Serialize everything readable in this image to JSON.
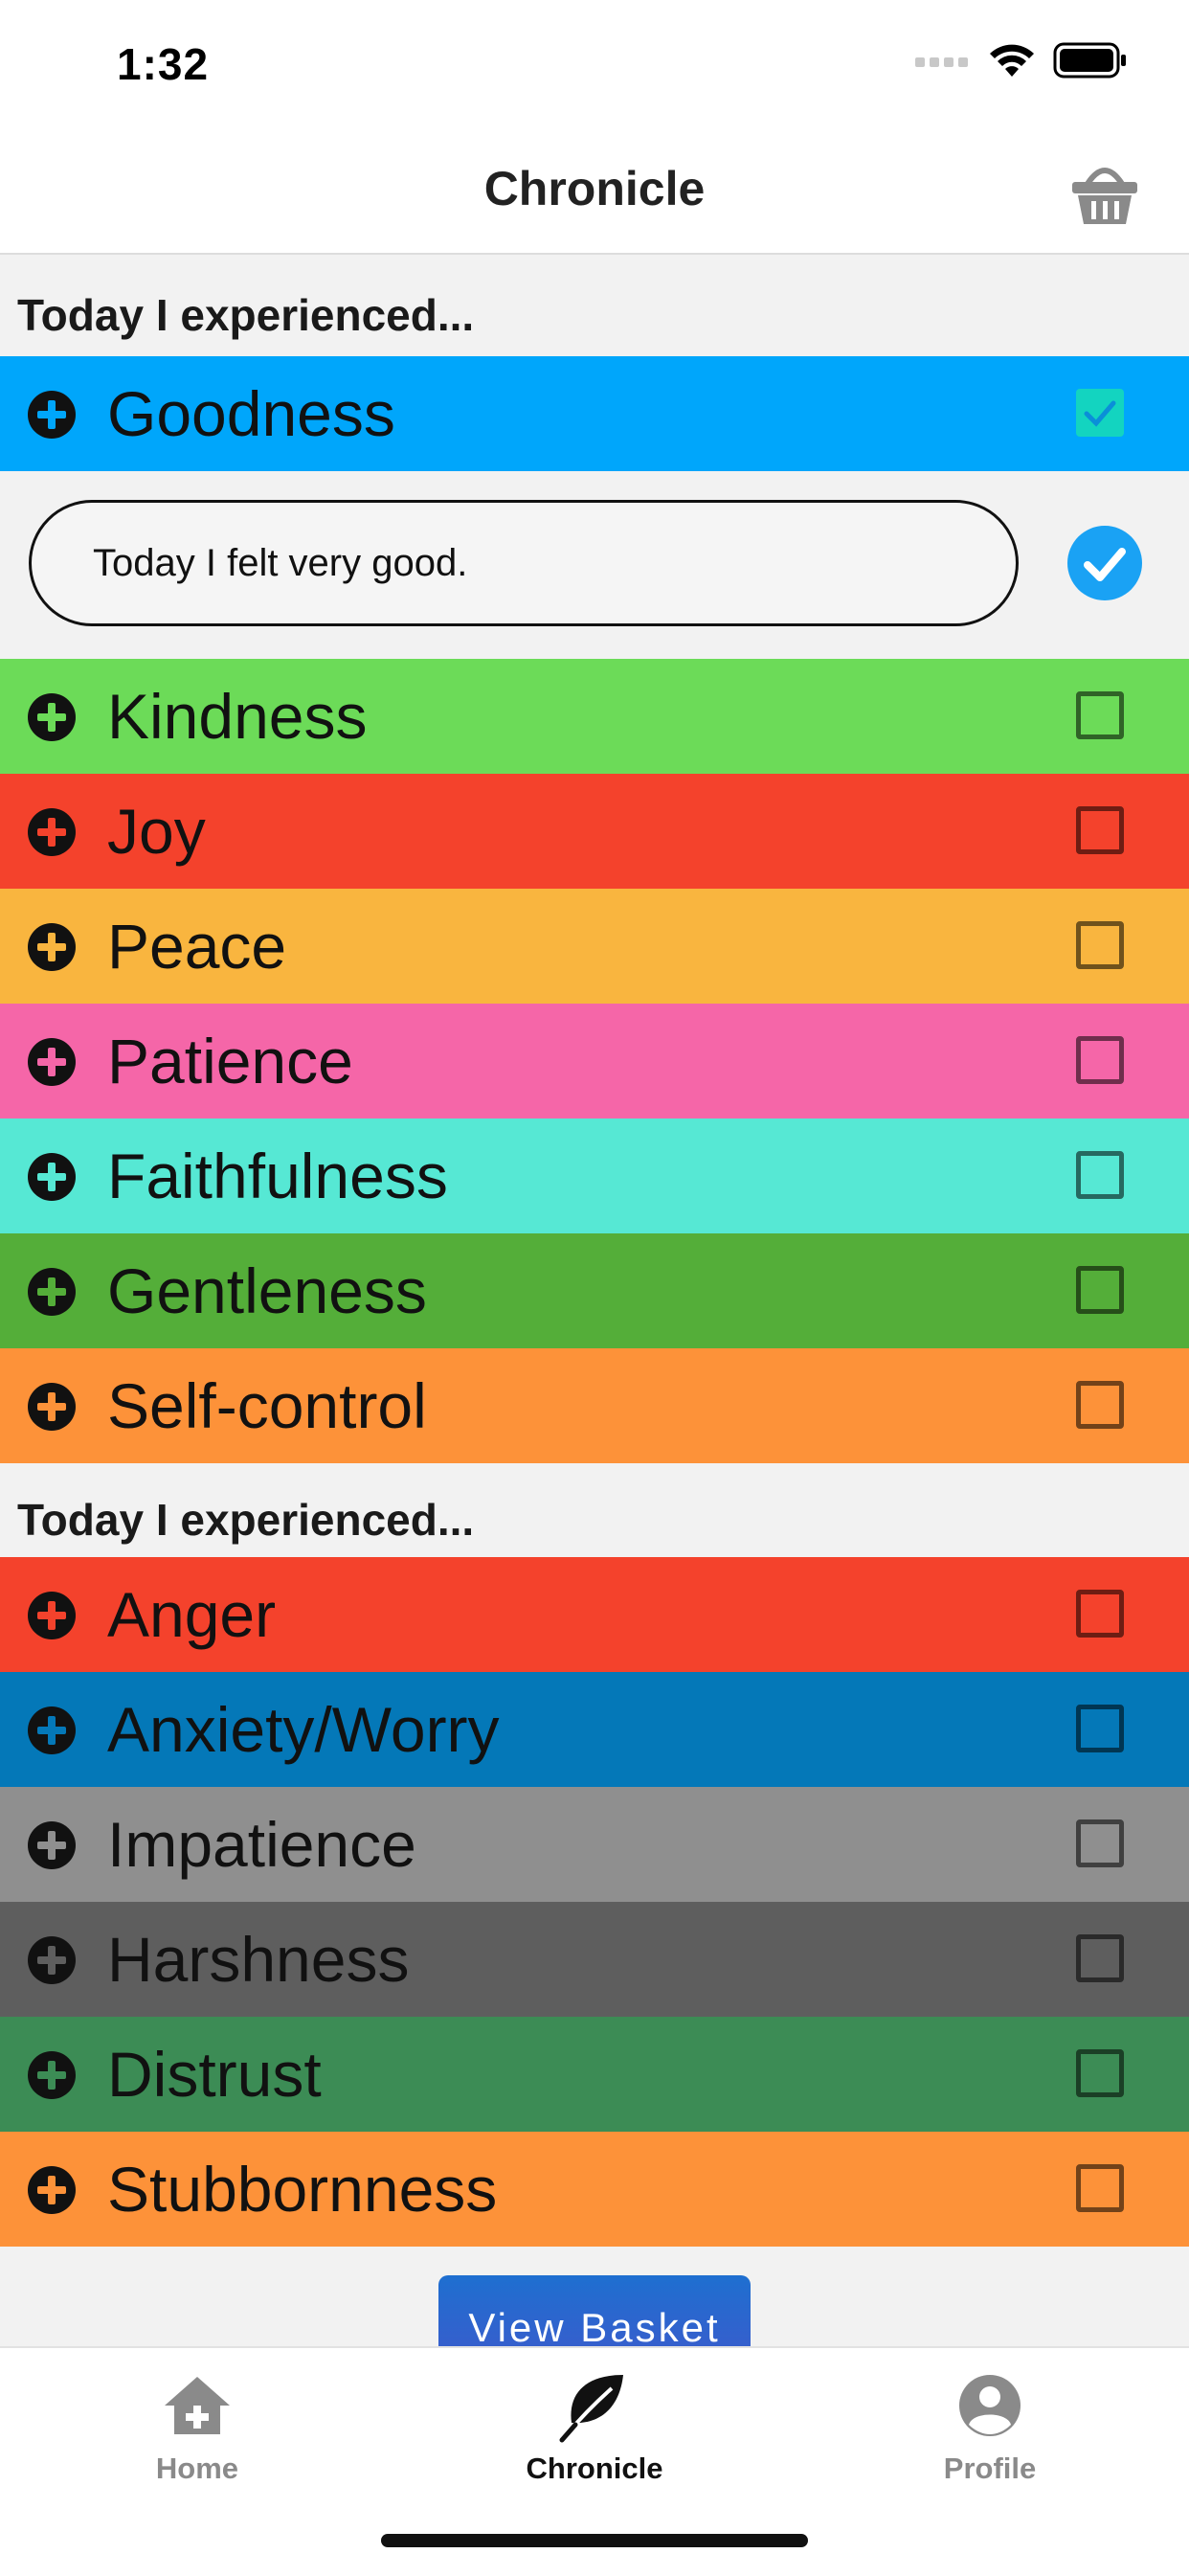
{
  "status_bar": {
    "time": "1:32"
  },
  "nav": {
    "title": "Chronicle",
    "basket_icon": "basket-icon"
  },
  "sections": {
    "fruits_header": "Today I experienced...",
    "struggles_header": "Today I experienced..."
  },
  "fruits": [
    {
      "label": "Goodness",
      "color": "#00a6fb",
      "checked": true
    },
    {
      "label": "Kindness",
      "color": "#6cdb58",
      "checked": false
    },
    {
      "label": "Joy",
      "color": "#f4422c",
      "checked": false
    },
    {
      "label": "Peace",
      "color": "#f9b53f",
      "checked": false
    },
    {
      "label": "Patience",
      "color": "#f566a8",
      "checked": false
    },
    {
      "label": "Faithfulness",
      "color": "#56e8d4",
      "checked": false
    },
    {
      "label": "Gentleness",
      "color": "#54ae39",
      "checked": false
    },
    {
      "label": "Self-control",
      "color": "#fd9239",
      "checked": false
    }
  ],
  "note": {
    "value": "Today I felt very good.",
    "confirm_color": "#1aa2f4"
  },
  "struggles": [
    {
      "label": "Anger",
      "color": "#f4422c",
      "checked": false
    },
    {
      "label": "Anxiety/Worry",
      "color": "#0478b8",
      "checked": false
    },
    {
      "label": "Impatience",
      "color": "#8f8f8f",
      "checked": false
    },
    {
      "label": "Harshness",
      "color": "#5e5e5e",
      "checked": false
    },
    {
      "label": "Distrust",
      "color": "#3c8c55",
      "checked": false
    },
    {
      "label": "Stubbornness",
      "color": "#fd9239",
      "checked": false
    }
  ],
  "actions": {
    "view_basket": "View Basket"
  },
  "tabs": [
    {
      "label": "Home",
      "icon": "home-icon",
      "active": false
    },
    {
      "label": "Chronicle",
      "icon": "leaf-icon",
      "active": true
    },
    {
      "label": "Profile",
      "icon": "profile-icon",
      "active": false
    }
  ]
}
